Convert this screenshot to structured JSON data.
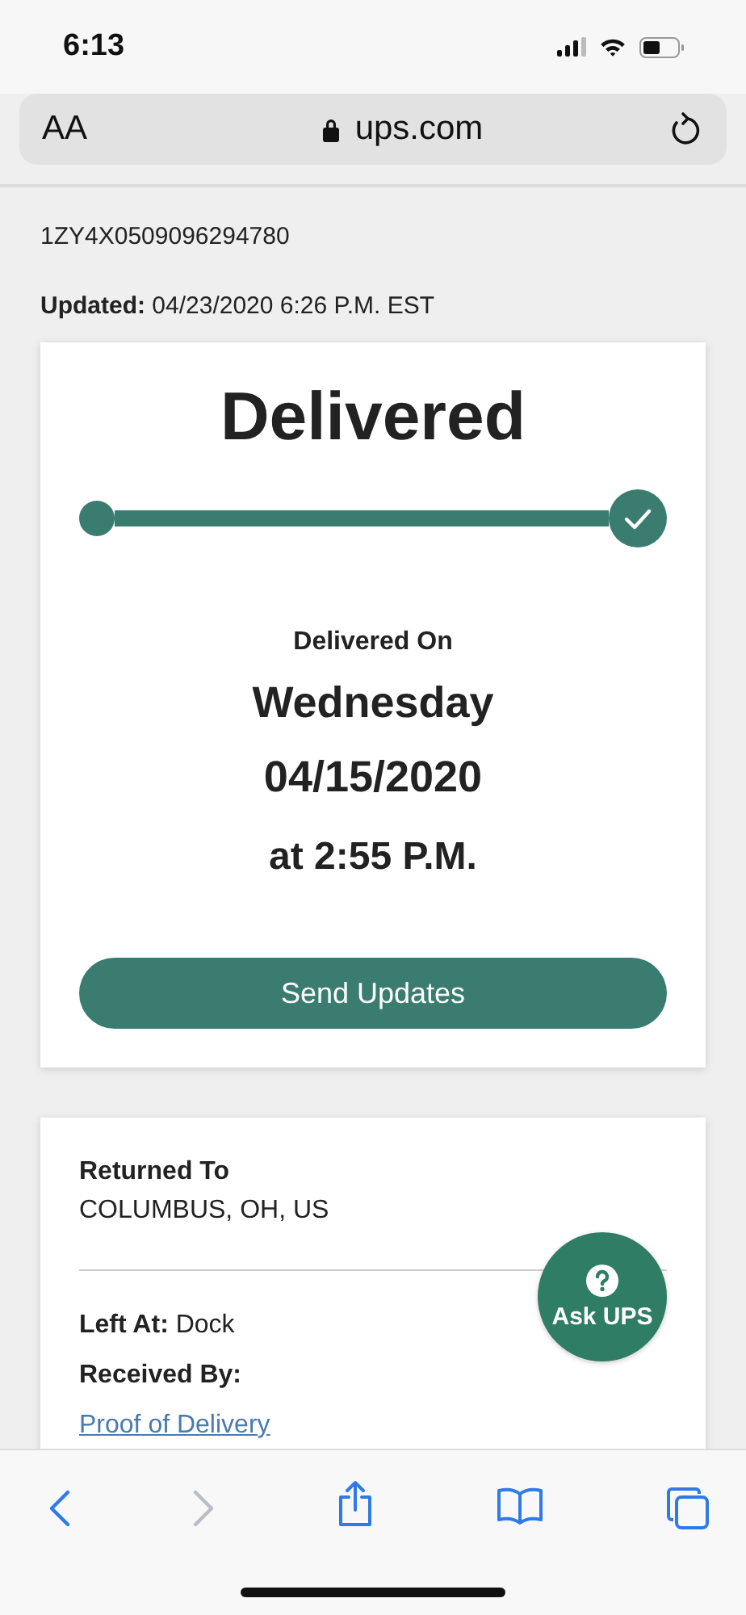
{
  "status_bar": {
    "time": "6:13"
  },
  "address_bar": {
    "text_size": "AA",
    "url": "ups.com"
  },
  "tracking_number": "1ZY4X0509096294780",
  "updated": {
    "label": "Updated:",
    "value": "04/23/2020 6:26 P.M. EST"
  },
  "status_card": {
    "status": "Delivered",
    "progress": {
      "complete": true
    },
    "delivered_on_label": "Delivered On",
    "day": "Wednesday",
    "date": "04/15/2020",
    "time": "at 2:55 P.M.",
    "button": "Send Updates"
  },
  "details_card": {
    "returned_to_label": "Returned To",
    "returned_to": "COLUMBUS, OH, US",
    "left_at_label": "Left At:",
    "left_at": "Dock",
    "received_by_label": "Received By:",
    "link": "Proof of Delivery"
  },
  "ask_button": "Ask UPS",
  "toolbar": [
    {
      "kind": "back",
      "disabled": false
    },
    {
      "kind": "forward",
      "disabled": true
    },
    {
      "kind": "share",
      "disabled": false
    },
    {
      "kind": "bookmarks",
      "disabled": false
    },
    {
      "kind": "tabs",
      "disabled": false
    }
  ]
}
